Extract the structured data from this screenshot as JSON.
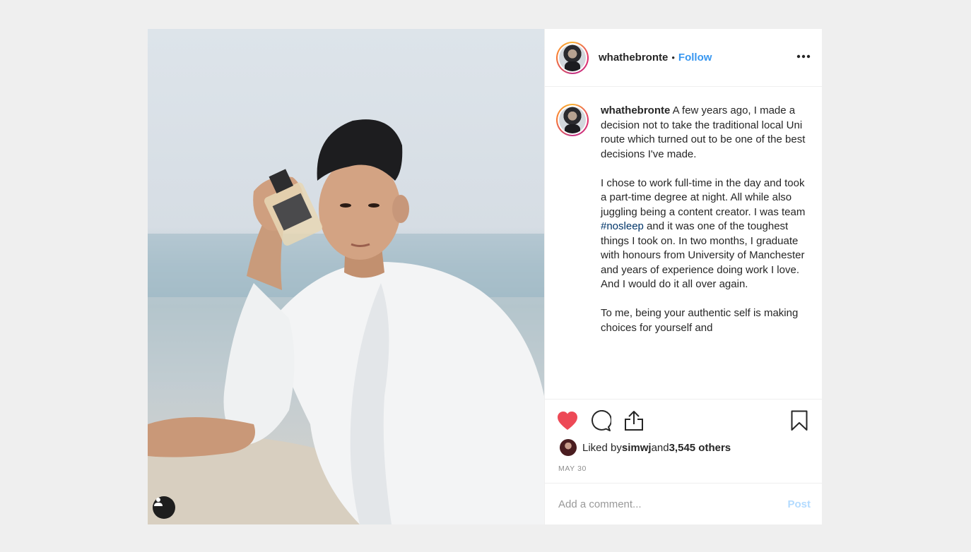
{
  "header": {
    "username": "whathebronte",
    "separator": "•",
    "follow_label": "Follow",
    "more_label": "•••"
  },
  "caption": {
    "username": "whathebronte",
    "text_before_hashtag": " A few years ago, I made a decision not to take the traditional local Uni route which turned out to be one of the best decisions I've made.\n\nI chose to work full-time in the day and took a part-time degree at night. All while also juggling being a content creator. I was team ",
    "hashtag": "#nosleep",
    "text_after_hashtag": " and it was one of the toughest things I took on. In two months, I graduate with honours from University of Manchester and years of experience doing work I love. And I would do it all over again.\n\nTo me, being your authentic self is making choices for yourself and"
  },
  "actions": {
    "like_icon": "heart-icon",
    "comment_icon": "comment-icon",
    "share_icon": "share-icon",
    "save_icon": "bookmark-icon",
    "liked_state": true
  },
  "likes": {
    "prefix": "Liked by ",
    "user": "simwj",
    "middle": " and ",
    "count": "3,545 others"
  },
  "date": "MAY 30",
  "comment": {
    "placeholder": "Add a comment...",
    "value": "",
    "post_label": "Post"
  },
  "colors": {
    "accent": "#3897f0",
    "like_red": "#ed4956",
    "hashtag": "#003569",
    "post_disabled": "#b3dbff",
    "background": "#efefef"
  },
  "photo": {
    "user_tag_icon": "person-icon"
  }
}
